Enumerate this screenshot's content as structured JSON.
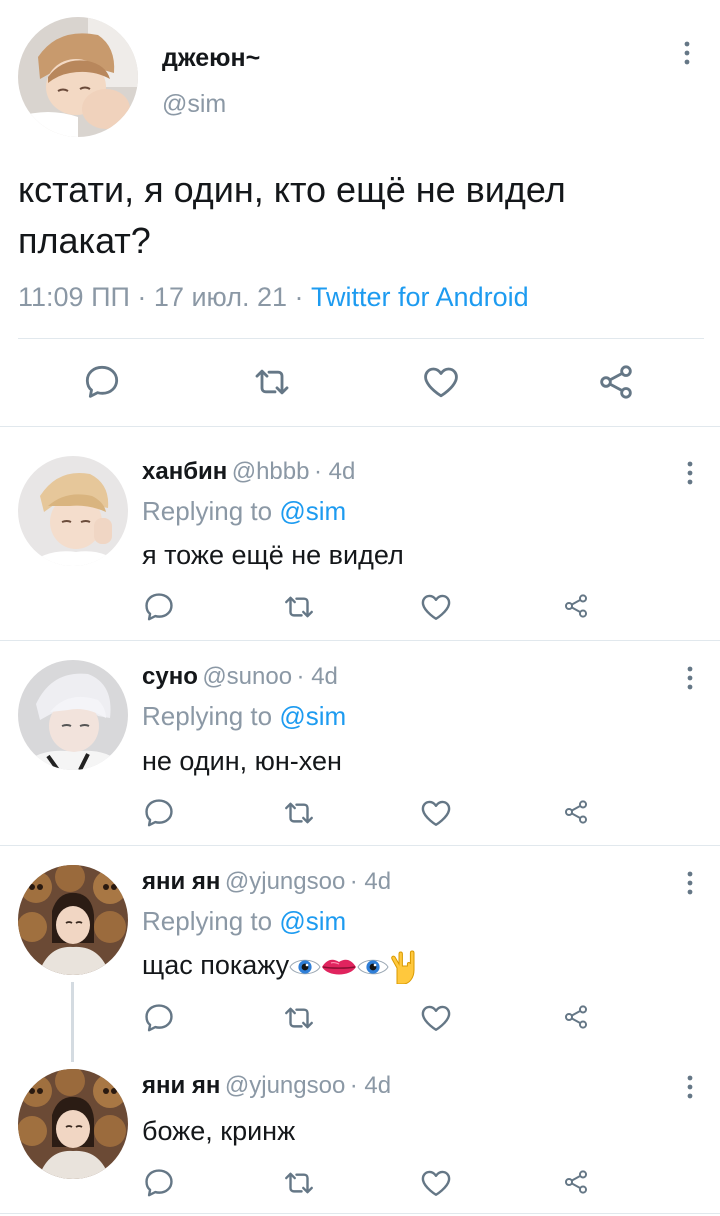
{
  "main_tweet": {
    "display_name": "джеюн~",
    "handle": "@sim",
    "text": "кстати, я один, кто ещё не видел плакат?",
    "time": "11:09 ПП",
    "dot1": "·",
    "date": "17 июл. 21",
    "dot2": "·",
    "source": "Twitter for Android",
    "actions": [
      "reply-icon",
      "retweet-icon",
      "like-icon",
      "share-icon"
    ]
  },
  "replies": [
    {
      "display_name": "ханбин",
      "handle": "@hbbb",
      "meta": "· 4d",
      "replying_prefix": "Replying to",
      "replying_to": "@sim",
      "text": "я тоже ещё не видел"
    },
    {
      "display_name": "суно",
      "handle": "@sunoo",
      "meta": "· 4d",
      "replying_prefix": "Replying to",
      "replying_to": "@sim",
      "text": "не один, юн-хен"
    },
    {
      "display_name": "яни ян",
      "handle": "@yjungsoo",
      "meta": "· 4d",
      "replying_prefix": "Replying to",
      "replying_to": "@sim",
      "text": "щас покажу",
      "emoji": [
        "eye",
        "lips",
        "eye",
        "love-you-gesture"
      ]
    },
    {
      "display_name": "яни ян",
      "handle": "@yjungsoo",
      "meta": "· 4d",
      "text": "боже, кринж"
    }
  ],
  "colors": {
    "accent": "#1d9bf0",
    "secondary_text": "#8b98a5",
    "divider": "#e1e8ed",
    "icon": "#657786"
  }
}
